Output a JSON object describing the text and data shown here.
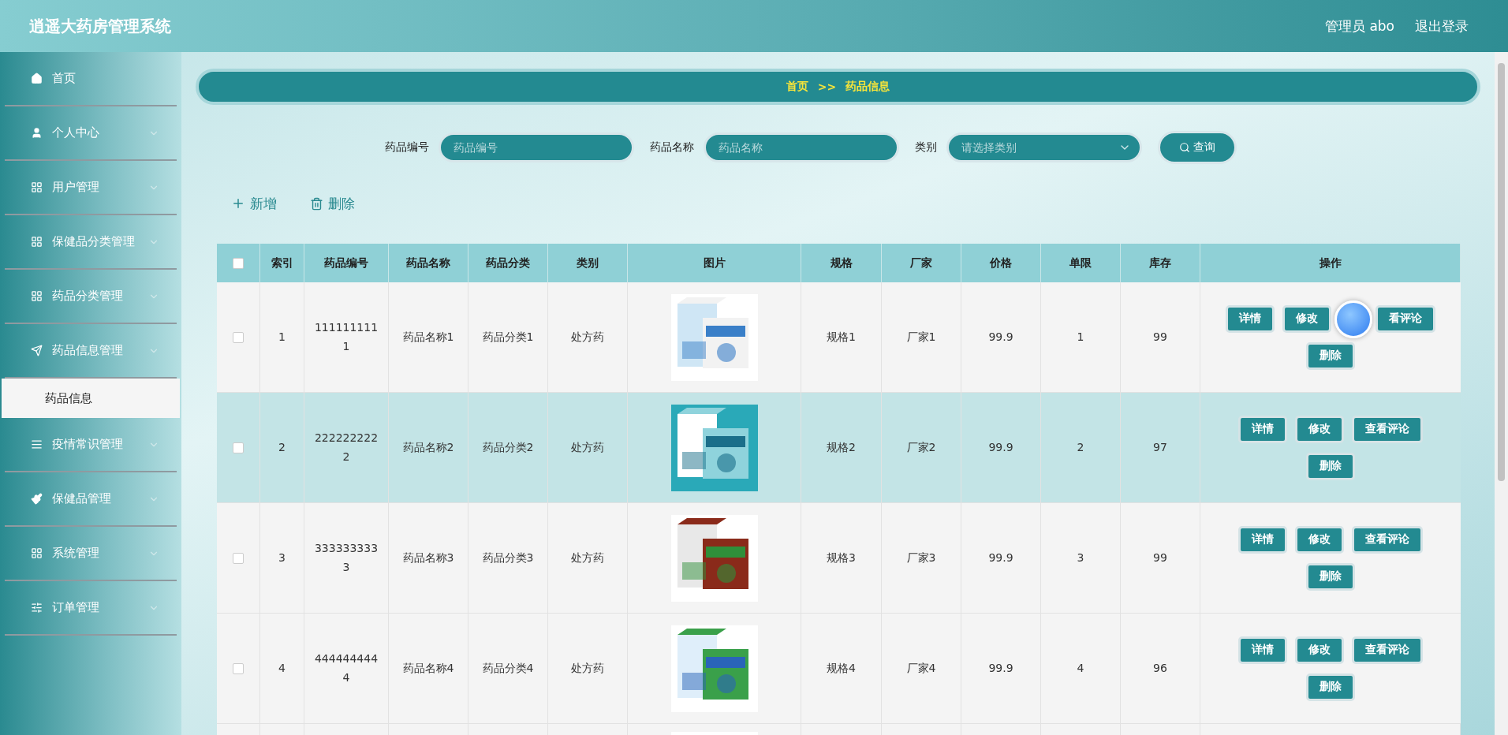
{
  "header": {
    "title": "逍遥大药房管理系统",
    "user": "管理员 abo",
    "logout": "退出登录"
  },
  "sidebar": {
    "items": [
      {
        "label": "首页",
        "has_arrow": false
      },
      {
        "label": "个人中心",
        "has_arrow": true
      },
      {
        "label": "用户管理",
        "has_arrow": true
      },
      {
        "label": "保健品分类管理",
        "has_arrow": true
      },
      {
        "label": "药品分类管理",
        "has_arrow": true
      },
      {
        "label": "药品信息管理",
        "has_arrow": true,
        "children": [
          {
            "label": "药品信息",
            "selected": true
          }
        ]
      },
      {
        "label": "疫情常识管理",
        "has_arrow": true
      },
      {
        "label": "保健品管理",
        "has_arrow": true
      },
      {
        "label": "系统管理",
        "has_arrow": true
      },
      {
        "label": "订单管理",
        "has_arrow": true
      }
    ]
  },
  "breadcrumb": [
    "首页",
    ">>",
    "药品信息"
  ],
  "search": {
    "fields": [
      {
        "label": "药品编号",
        "placeholder": "药品编号",
        "kind": "input"
      },
      {
        "label": "药品名称",
        "placeholder": "药品名称",
        "kind": "input"
      },
      {
        "label": "类别",
        "placeholder": "请选择类别",
        "kind": "select"
      }
    ],
    "button": "查询"
  },
  "actions": [
    "新增",
    "删除"
  ],
  "table": {
    "columns": [
      "索引",
      "药品编号",
      "药品名称",
      "药品分类",
      "类别",
      "图片",
      "规格",
      "厂家",
      "价格",
      "单限",
      "库存",
      "操作"
    ],
    "header_checked": false,
    "rows": [
      {
        "checked": false,
        "highlighted": false,
        "cells": [
          "1",
          "1111111111",
          "药品名称1",
          "药品分类1",
          "处方药",
          null,
          "规格1",
          "厂家1",
          "99.9",
          "1",
          "99"
        ],
        "floating_ball": true,
        "buttons": [
          "详情",
          "修改",
          "看评论",
          "删除"
        ]
      },
      {
        "checked": false,
        "highlighted": true,
        "cells": [
          "2",
          "2222222222",
          "药品名称2",
          "药品分类2",
          "处方药",
          null,
          "规格2",
          "厂家2",
          "99.9",
          "2",
          "97"
        ],
        "floating_ball": false,
        "buttons": [
          "详情",
          "修改",
          "查看评论",
          "删除"
        ]
      },
      {
        "checked": false,
        "highlighted": false,
        "cells": [
          "3",
          "3333333333",
          "药品名称3",
          "药品分类3",
          "处方药",
          null,
          "规格3",
          "厂家3",
          "99.9",
          "3",
          "99"
        ],
        "floating_ball": false,
        "buttons": [
          "详情",
          "修改",
          "查看评论",
          "删除"
        ]
      },
      {
        "checked": false,
        "highlighted": false,
        "cells": [
          "4",
          "4444444444",
          "药品名称4",
          "药品分类4",
          "处方药",
          null,
          "规格4",
          "厂家4",
          "99.9",
          "4",
          "96"
        ],
        "floating_ball": false,
        "buttons": [
          "详情",
          "修改",
          "查看评论",
          "删除"
        ]
      }
    ]
  }
}
